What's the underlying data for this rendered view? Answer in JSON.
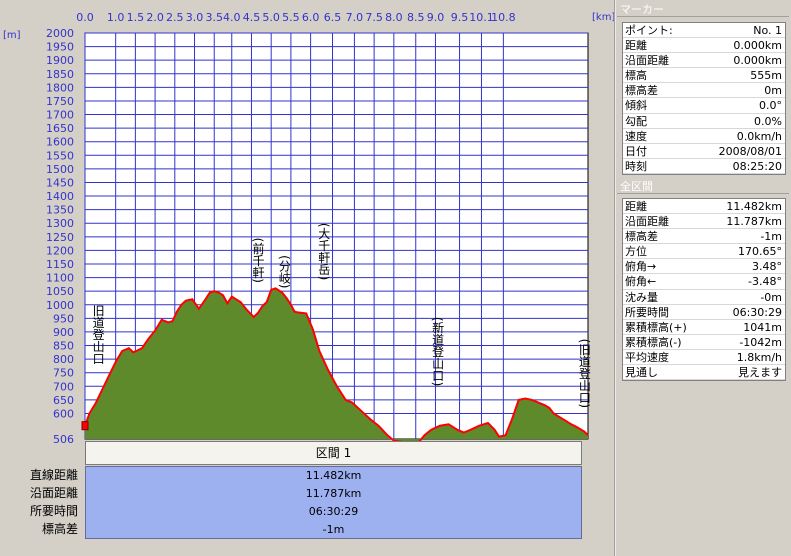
{
  "chart_data": {
    "type": "area",
    "xlabel": "[km]",
    "ylabel": "[m]",
    "xlim": [
      0,
      11.482
    ],
    "ylim": [
      506,
      2000
    ],
    "x_ticks": [
      "0.0",
      "1.0",
      "1.5",
      "2.0",
      "2.5",
      "3.0",
      "3.5",
      "4.0",
      "4.5",
      "5.0",
      "5.5",
      "6.0",
      "6.5",
      "7.0",
      "7.5",
      "8.0",
      "8.5",
      "9.0",
      "9.5",
      "10.1",
      "10.8"
    ],
    "x_tick_values": [
      0.0,
      0.7,
      1.15,
      1.6,
      2.05,
      2.5,
      2.95,
      3.35,
      3.8,
      4.25,
      4.7,
      5.15,
      5.65,
      6.15,
      6.6,
      7.05,
      7.55,
      8.0,
      8.55,
      9.05,
      9.55
    ],
    "y_ticks": [
      600,
      650,
      700,
      750,
      800,
      850,
      900,
      950,
      1000,
      1050,
      1100,
      1150,
      1200,
      1250,
      1300,
      1350,
      1400,
      1450,
      1500,
      1550,
      1600,
      1650,
      1700,
      1750,
      1800,
      1850,
      1900,
      1950,
      2000
    ],
    "y_min_label": "506",
    "grid": true,
    "fill_color": "#5f8a2c",
    "line_color": "#ff0000",
    "plot_bg": "#ffffff",
    "grid_color": "#3333cc",
    "series": [
      {
        "x": [
          0.0,
          0.1,
          0.25,
          0.4,
          0.55,
          0.7,
          0.85,
          1.0,
          1.1,
          1.2,
          1.3,
          1.45,
          1.6,
          1.75,
          1.9,
          2.0,
          2.1,
          2.2,
          2.3,
          2.45,
          2.6,
          2.75,
          2.85,
          2.95,
          3.05,
          3.15,
          3.25,
          3.35,
          3.45,
          3.55,
          3.7,
          3.85,
          3.95,
          4.05,
          4.15,
          4.25,
          4.35,
          4.5,
          4.6,
          4.7,
          4.78,
          4.85,
          4.95,
          5.05,
          5.2,
          5.35,
          5.55,
          5.75,
          5.95,
          6.1,
          6.3,
          6.5,
          6.7,
          6.9,
          7.05,
          7.25,
          7.45,
          7.6,
          7.75,
          7.9,
          8.1,
          8.3,
          8.5,
          8.65,
          8.8,
          9.0,
          9.2,
          9.35,
          9.45,
          9.6,
          9.75,
          9.9,
          10.05,
          10.2,
          10.35,
          10.5,
          10.6,
          10.7,
          10.8,
          10.95,
          11.1,
          11.25,
          11.4,
          11.482
        ],
        "y": [
          555,
          600,
          640,
          690,
          740,
          790,
          830,
          840,
          825,
          832,
          840,
          875,
          905,
          945,
          935,
          940,
          975,
          1000,
          1015,
          1020,
          985,
          1020,
          1045,
          1050,
          1045,
          1035,
          1005,
          1030,
          1020,
          1010,
          980,
          955,
          970,
          995,
          1010,
          1055,
          1060,
          1045,
          1025,
          1000,
          975,
          972,
          970,
          968,
          910,
          830,
          760,
          700,
          650,
          640,
          610,
          580,
          555,
          520,
          500,
          495,
          480,
          490,
          520,
          540,
          555,
          560,
          540,
          530,
          540,
          555,
          565,
          540,
          515,
          520,
          580,
          650,
          655,
          650,
          640,
          630,
          620,
          600,
          590,
          575,
          560,
          548,
          533,
          520
        ]
      }
    ],
    "annotations": [
      {
        "label": "旧道登山口",
        "x": 0.3,
        "y": 780
      },
      {
        "label": "(前千軒)",
        "x": 3.95,
        "y": 1080
      },
      {
        "label": "(分岐)",
        "x": 4.55,
        "y": 1060
      },
      {
        "label": "(大千軒岳)",
        "x": 5.45,
        "y": 1090
      },
      {
        "label": "(新道登山口)",
        "x": 8.05,
        "y": 700
      },
      {
        "label": "(旧道登山口)",
        "x": 11.4,
        "y": 620
      }
    ]
  },
  "section": {
    "title": "区間 1",
    "rows": [
      {
        "label": "直線距離",
        "value": "11.482km"
      },
      {
        "label": "沿面距離",
        "value": "11.787km"
      },
      {
        "label": "所要時間",
        "value": "06:30:29"
      },
      {
        "label": "標高差",
        "value": "-1m"
      }
    ]
  },
  "marker_panel": {
    "title": "マーカー",
    "rows": [
      {
        "k": "ポイント:",
        "v": "No. 1"
      },
      {
        "k": "距離",
        "v": "0.000km"
      },
      {
        "k": "沿面距離",
        "v": "0.000km"
      },
      {
        "k": "標高",
        "v": "555m"
      },
      {
        "k": "標高差",
        "v": "0m"
      },
      {
        "k": "傾斜",
        "v": "0.0°"
      },
      {
        "k": "勾配",
        "v": "0.0%"
      },
      {
        "k": "速度",
        "v": "0.0km/h"
      },
      {
        "k": "日付",
        "v": "2008/08/01"
      },
      {
        "k": "時刻",
        "v": "08:25:20"
      }
    ]
  },
  "all_panel": {
    "title": "全区間",
    "rows": [
      {
        "k": "距離",
        "v": "11.482km"
      },
      {
        "k": "沿面距離",
        "v": "11.787km"
      },
      {
        "k": "標高差",
        "v": "-1m"
      },
      {
        "k": "方位",
        "v": "170.65°"
      },
      {
        "k": "俯角→",
        "v": "3.48°"
      },
      {
        "k": "俯角←",
        "v": "-3.48°"
      },
      {
        "k": "沈み量",
        "v": "-0m"
      },
      {
        "k": "所要時間",
        "v": "06:30:29"
      },
      {
        "k": "累積標高(+)",
        "v": "1041m"
      },
      {
        "k": "累積標高(-)",
        "v": "-1042m"
      },
      {
        "k": "平均速度",
        "v": "1.8km/h"
      },
      {
        "k": "見通し",
        "v": "見えます"
      }
    ]
  }
}
